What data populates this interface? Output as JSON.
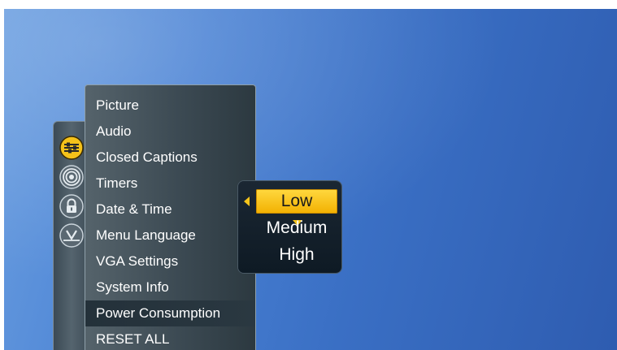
{
  "menu": {
    "items": [
      {
        "label": "Picture"
      },
      {
        "label": "Audio"
      },
      {
        "label": "Closed Captions"
      },
      {
        "label": "Timers"
      },
      {
        "label": "Date & Time"
      },
      {
        "label": "Menu Language"
      },
      {
        "label": "VGA Settings"
      },
      {
        "label": "System Info"
      },
      {
        "label": "Power Consumption"
      },
      {
        "label": "RESET ALL"
      }
    ],
    "selected_label": "Power Consumption"
  },
  "tabs": [
    {
      "icon": "settings-sliders-icon"
    },
    {
      "icon": "broadcast-antenna-icon"
    },
    {
      "icon": "lock-icon"
    },
    {
      "icon": "v-chip-icon"
    }
  ],
  "submenu": {
    "options": [
      "Low",
      "Medium",
      "High"
    ],
    "selected": "Low"
  },
  "colors": {
    "accent": "#f7c51b",
    "background": "#3a6fc4",
    "panel": "#3c4a53"
  }
}
